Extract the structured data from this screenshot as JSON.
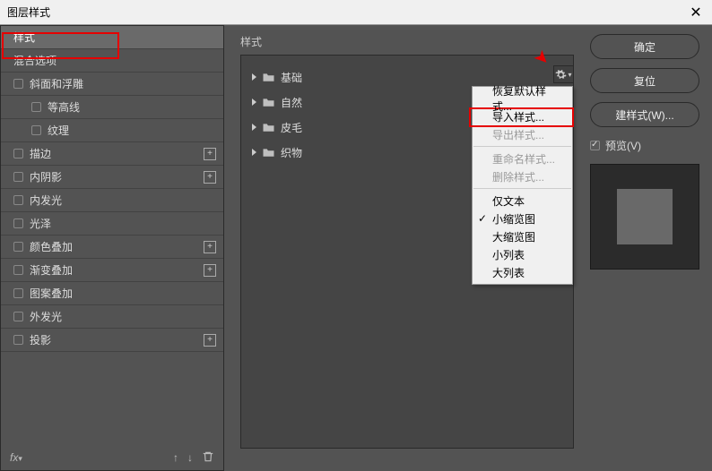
{
  "dialog": {
    "title": "图层样式",
    "close": "✕"
  },
  "left": {
    "header": "样式",
    "blending": "混合选项",
    "bevel": "斜面和浮雕",
    "contour": "等高线",
    "texture": "纹理",
    "stroke": "描边",
    "innerShadow": "内阴影",
    "innerGlow": "内发光",
    "satin": "光泽",
    "colorOverlay": "颜色叠加",
    "gradientOverlay": "渐变叠加",
    "patternOverlay": "图案叠加",
    "outerGlow": "外发光",
    "dropShadow": "投影",
    "fx": "fx",
    "plus": "+"
  },
  "center": {
    "title": "样式",
    "folders": [
      "基础",
      "自然",
      "皮毛",
      "织物"
    ]
  },
  "menu": {
    "restore": "恢复默认样式...",
    "import": "导入样式...",
    "export": "导出样式...",
    "rename": "重命名样式...",
    "delete": "删除样式...",
    "textOnly": "仅文本",
    "smallThumb": "小缩览图",
    "largeThumb": "大缩览图",
    "smallList": "小列表",
    "largeList": "大列表"
  },
  "right": {
    "ok": "确定",
    "reset": "复位",
    "newStyle": "建样式(W)...",
    "preview": "预览(V)"
  }
}
